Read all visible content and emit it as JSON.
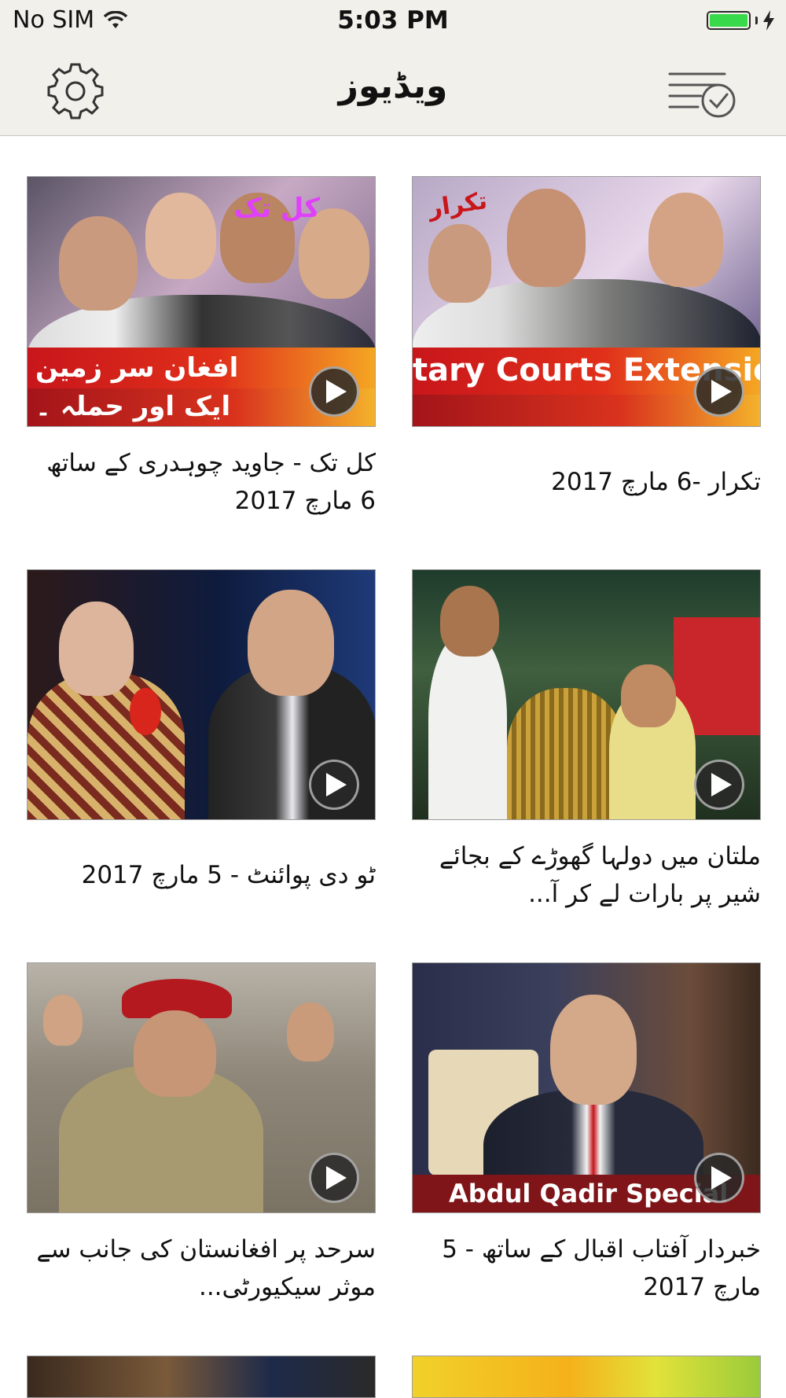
{
  "status_bar": {
    "carrier": "No SIM",
    "time": "5:03 PM",
    "battery_level": 1.0
  },
  "nav": {
    "title": "ویڈیوز",
    "left_icon": "gear-icon",
    "right_icon": "playlist-check-icon"
  },
  "videos": [
    {
      "title": "کل تک - جاوید چوہدری کے ساتھ 6 مارچ 2017",
      "thumb_text": [
        "افغان سر زمین",
        "ایک اور حملہ ۔"
      ],
      "logo_text": "کل تک"
    },
    {
      "title": "تکرار -6 مارچ 2017",
      "thumb_text": [
        "tary Courts Extensio"
      ],
      "logo_text": "تکرار"
    },
    {
      "title": "ٹو دی پوائنٹ - 5 مارچ 2017"
    },
    {
      "title": "ملتان میں دولہا گھوڑے کے بجائے شیر پر بارات لے کر آ..."
    },
    {
      "title": "سرحد پر افغانستان کی جانب سے موثر سیکیورٹی..."
    },
    {
      "title": "خبردار آفتاب اقبال کے ساتھ - 5 مارچ 2017",
      "thumb_text": [
        "Abdul Qadir Special"
      ]
    }
  ],
  "colors": {
    "bar_bg": "#f2f0ea",
    "battery": "#38d94a",
    "banner_red": "#c8161b"
  }
}
